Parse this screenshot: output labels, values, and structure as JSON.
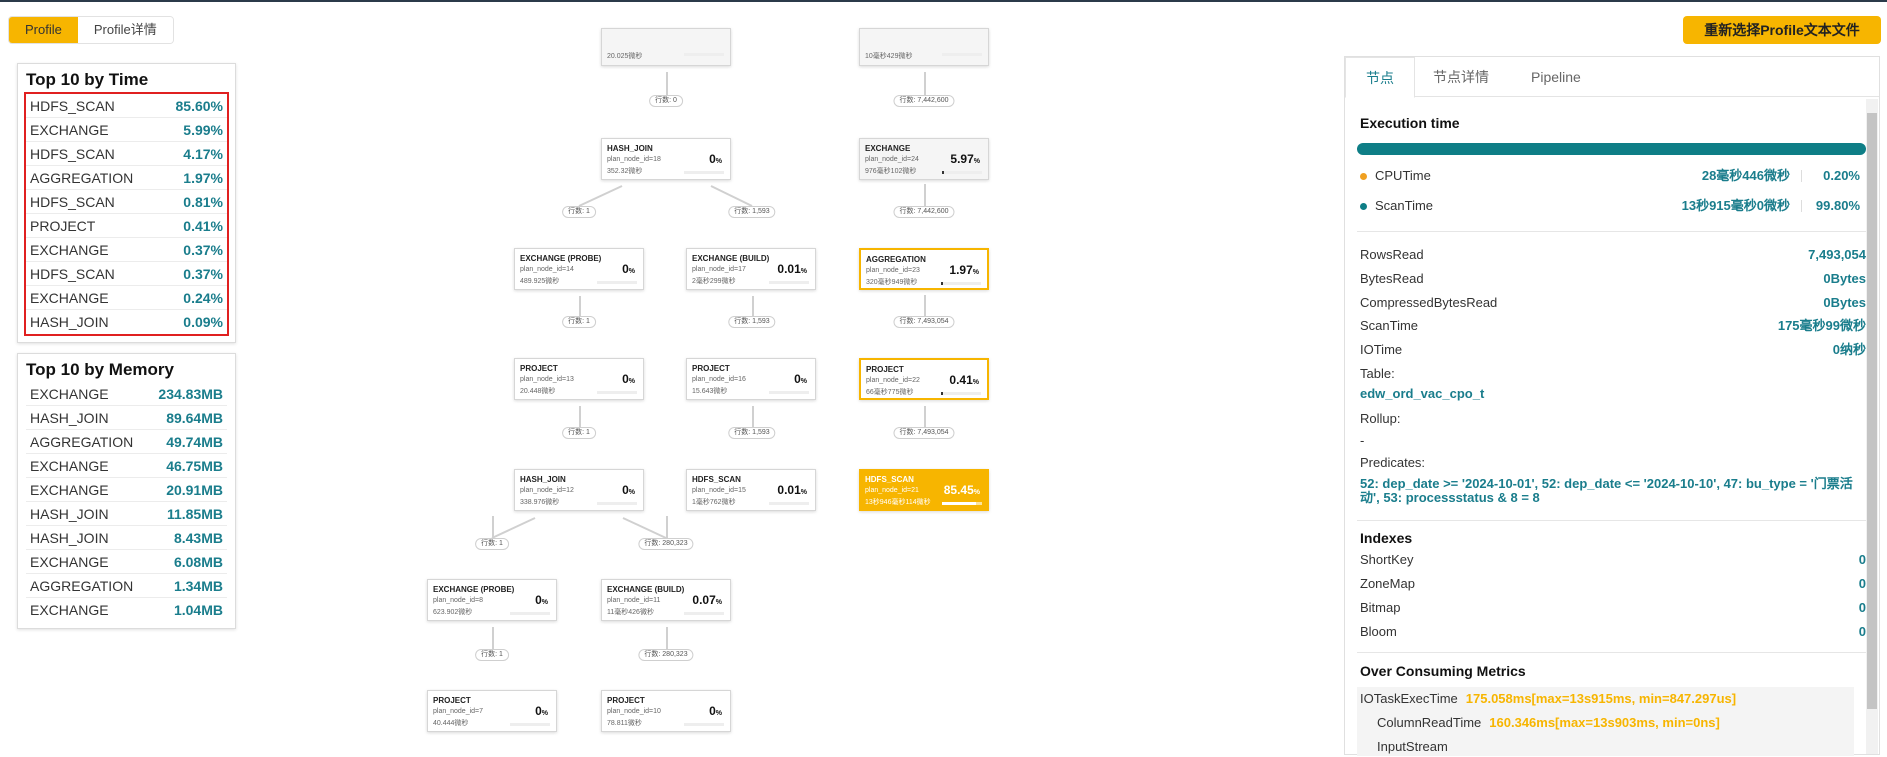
{
  "view_toggle": {
    "profile": "Profile",
    "profile_detail": "Profile详情"
  },
  "reselect_label": "重新选择Profile文本文件",
  "top_time": {
    "title": "Top 10 by Time",
    "rows": [
      {
        "name": "HDFS_SCAN",
        "value": "85.60%"
      },
      {
        "name": "EXCHANGE",
        "value": "5.99%"
      },
      {
        "name": "HDFS_SCAN",
        "value": "4.17%"
      },
      {
        "name": "AGGREGATION",
        "value": "1.97%"
      },
      {
        "name": "HDFS_SCAN",
        "value": "0.81%"
      },
      {
        "name": "PROJECT",
        "value": "0.41%"
      },
      {
        "name": "EXCHANGE",
        "value": "0.37%"
      },
      {
        "name": "HDFS_SCAN",
        "value": "0.37%"
      },
      {
        "name": "EXCHANGE",
        "value": "0.24%"
      },
      {
        "name": "HASH_JOIN",
        "value": "0.09%"
      }
    ]
  },
  "top_memory": {
    "title": "Top 10 by Memory",
    "rows": [
      {
        "name": "EXCHANGE",
        "value": "234.83MB"
      },
      {
        "name": "HASH_JOIN",
        "value": "89.64MB"
      },
      {
        "name": "AGGREGATION",
        "value": "49.74MB"
      },
      {
        "name": "EXCHANGE",
        "value": "46.75MB"
      },
      {
        "name": "EXCHANGE",
        "value": "20.91MB"
      },
      {
        "name": "HASH_JOIN",
        "value": "11.85MB"
      },
      {
        "name": "HASH_JOIN",
        "value": "8.43MB"
      },
      {
        "name": "EXCHANGE",
        "value": "6.08MB"
      },
      {
        "name": "AGGREGATION",
        "value": "1.34MB"
      },
      {
        "name": "EXCHANGE",
        "value": "1.04MB"
      }
    ]
  },
  "graph": {
    "nodes": [
      {
        "id": "top-a",
        "name": "",
        "id_text": "",
        "time": "20.025微秒",
        "pct": "",
        "bar": 0,
        "variant": "light"
      },
      {
        "id": "top-b",
        "name": "",
        "id_text": "",
        "time": "10毫秒429微秒",
        "pct": "",
        "bar": 0,
        "variant": "light"
      },
      {
        "id": "hj18",
        "name": "HASH_JOIN",
        "id_text": "plan_node_id=18",
        "time": "352.32微秒",
        "pct": "0",
        "bar": 0,
        "variant": ""
      },
      {
        "id": "ex24",
        "name": "EXCHANGE",
        "id_text": "plan_node_id=24",
        "time": "976毫秒102微秒",
        "pct": "5.97",
        "bar": 0.06,
        "variant": "light"
      },
      {
        "id": "ex14",
        "name": "EXCHANGE (PROBE)",
        "id_text": "plan_node_id=14",
        "time": "489.925微秒",
        "pct": "0",
        "bar": 0,
        "variant": ""
      },
      {
        "id": "ex17",
        "name": "EXCHANGE (BUILD)",
        "id_text": "plan_node_id=17",
        "time": "2毫秒299微秒",
        "pct": "0.01",
        "bar": 0,
        "variant": ""
      },
      {
        "id": "ag23",
        "name": "AGGREGATION",
        "id_text": "plan_node_id=23",
        "time": "320毫秒949微秒",
        "pct": "1.97",
        "bar": 0.02,
        "variant": "warn"
      },
      {
        "id": "pj13",
        "name": "PROJECT",
        "id_text": "plan_node_id=13",
        "time": "20.448微秒",
        "pct": "0",
        "bar": 0,
        "variant": ""
      },
      {
        "id": "pj16",
        "name": "PROJECT",
        "id_text": "plan_node_id=16",
        "time": "15.643微秒",
        "pct": "0",
        "bar": 0,
        "variant": ""
      },
      {
        "id": "pj22",
        "name": "PROJECT",
        "id_text": "plan_node_id=22",
        "time": "66毫秒775微秒",
        "pct": "0.41",
        "bar": 0.01,
        "variant": "warn"
      },
      {
        "id": "hj12",
        "name": "HASH_JOIN",
        "id_text": "plan_node_id=12",
        "time": "338.976微秒",
        "pct": "0",
        "bar": 0,
        "variant": ""
      },
      {
        "id": "hs15",
        "name": "HDFS_SCAN",
        "id_text": "plan_node_id=15",
        "time": "1毫秒762微秒",
        "pct": "0.01",
        "bar": 0,
        "variant": ""
      },
      {
        "id": "hs21",
        "name": "HDFS_SCAN",
        "id_text": "plan_node_id=21",
        "time": "13秒946毫秒114微秒",
        "pct": "85.45",
        "bar": 0.85,
        "variant": "hot"
      },
      {
        "id": "ex8",
        "name": "EXCHANGE (PROBE)",
        "id_text": "plan_node_id=8",
        "time": "623.902微秒",
        "pct": "0",
        "bar": 0,
        "variant": ""
      },
      {
        "id": "ex11",
        "name": "EXCHANGE (BUILD)",
        "id_text": "plan_node_id=11",
        "time": "11毫秒426微秒",
        "pct": "0.07",
        "bar": 0,
        "variant": ""
      },
      {
        "id": "pj7",
        "name": "PROJECT",
        "id_text": "plan_node_id=7",
        "time": "40.444微秒",
        "pct": "0",
        "bar": 0,
        "variant": ""
      },
      {
        "id": "pj10",
        "name": "PROJECT",
        "id_text": "plan_node_id=10",
        "time": "78.811微秒",
        "pct": "0",
        "bar": 0,
        "variant": ""
      }
    ],
    "pct_unit": "%",
    "edges": [
      {
        "label": "行数: 0"
      },
      {
        "label": "行数: 7,442,600"
      },
      {
        "label": "行数: 1"
      },
      {
        "label": "行数: 1,593"
      },
      {
        "label": "行数: 7,442,600"
      },
      {
        "label": "行数: 1"
      },
      {
        "label": "行数: 1,593"
      },
      {
        "label": "行数: 7,493,054"
      },
      {
        "label": "行数: 1"
      },
      {
        "label": "行数: 1,593"
      },
      {
        "label": "行数: 7,493,054"
      },
      {
        "label": "行数: 1"
      },
      {
        "label": "行数: 280,323"
      },
      {
        "label": "行数: 1"
      },
      {
        "label": "行数: 280,323"
      }
    ]
  },
  "panel": {
    "tabs": [
      "节点",
      "节点详情",
      "Pipeline"
    ],
    "exec_title": "Execution time",
    "cpu": {
      "name": "CPUTime",
      "value": "28毫秒446微秒",
      "pct": "0.20%",
      "color": "#f0a020"
    },
    "scan": {
      "name": "ScanTime",
      "value": "13秒915毫秒0微秒",
      "pct": "99.80%",
      "color": "#0e7e86"
    },
    "metrics": [
      {
        "k": "RowsRead",
        "v": "7,493,054"
      },
      {
        "k": "BytesRead",
        "v": "0Bytes"
      },
      {
        "k": "CompressedBytesRead",
        "v": "0Bytes"
      },
      {
        "k": "ScanTime",
        "v": "175毫秒99微秒"
      },
      {
        "k": "IOTime",
        "v": "0纳秒"
      }
    ],
    "table_label": "Table:",
    "table_value": "edw_ord_vac_cpo_t",
    "rollup_label": "Rollup:",
    "rollup_value": "-",
    "predicates_label": "Predicates:",
    "predicates_value": "52: dep_date >= '2024-10-01', 52: dep_date <= '2024-10-10', 47: bu_type = '门票活动', 53: processstatus & 8 = 8",
    "indexes_title": "Indexes",
    "indexes": [
      {
        "k": "ShortKey",
        "v": "0"
      },
      {
        "k": "ZoneMap",
        "v": "0"
      },
      {
        "k": "Bitmap",
        "v": "0"
      },
      {
        "k": "Bloom",
        "v": "0"
      }
    ],
    "over_title": "Over Consuming Metrics",
    "over": [
      {
        "k": "IOTaskExecTime",
        "v": "175.058ms[max=13s915ms, min=847.297us]"
      },
      {
        "k": "ColumnReadTime",
        "v": "160.346ms[max=13s903ms, min=0ns]"
      },
      {
        "k": "InputStream",
        "v": ""
      }
    ]
  }
}
